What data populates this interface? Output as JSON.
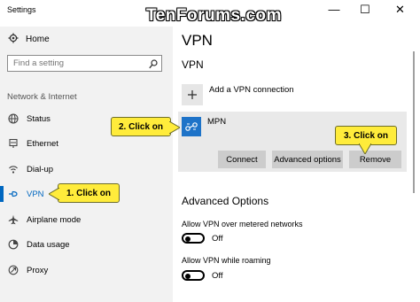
{
  "window": {
    "title": "Settings",
    "watermark": "TenForums.com",
    "minimize_glyph": "—",
    "maximize_glyph": "☐",
    "close_glyph": "✕"
  },
  "sidebar": {
    "home_label": "Home",
    "search_placeholder": "Find a setting",
    "section_label": "Network & Internet",
    "items": [
      {
        "label": "Status",
        "icon": "globe-icon"
      },
      {
        "label": "Ethernet",
        "icon": "ethernet-icon"
      },
      {
        "label": "Dial-up",
        "icon": "dialup-icon"
      },
      {
        "label": "VPN",
        "icon": "vpn-icon",
        "active": true
      },
      {
        "label": "Airplane mode",
        "icon": "airplane-icon"
      },
      {
        "label": "Data usage",
        "icon": "data-usage-icon"
      },
      {
        "label": "Proxy",
        "icon": "proxy-icon"
      }
    ]
  },
  "main": {
    "page_title": "VPN",
    "section_title": "VPN",
    "add_vpn_label": "Add a VPN connection",
    "connection": {
      "name": "MPN",
      "connect_label": "Connect",
      "advanced_label": "Advanced options",
      "remove_label": "Remove"
    },
    "advanced_title": "Advanced Options",
    "options": [
      {
        "label": "Allow VPN over metered networks",
        "state": "Off"
      },
      {
        "label": "Allow VPN while roaming",
        "state": "Off"
      }
    ]
  },
  "callouts": {
    "step1": "1. Click on",
    "step2": "2. Click on",
    "step3": "3. Click on"
  },
  "colors": {
    "accent": "#0067c0",
    "callout": "#ffec3b",
    "sidebar_bg": "#f2f2f2",
    "card_bg": "#e9e9e9",
    "button_bg": "#cccccc",
    "vpn_icon_bg": "#1e73c8"
  }
}
